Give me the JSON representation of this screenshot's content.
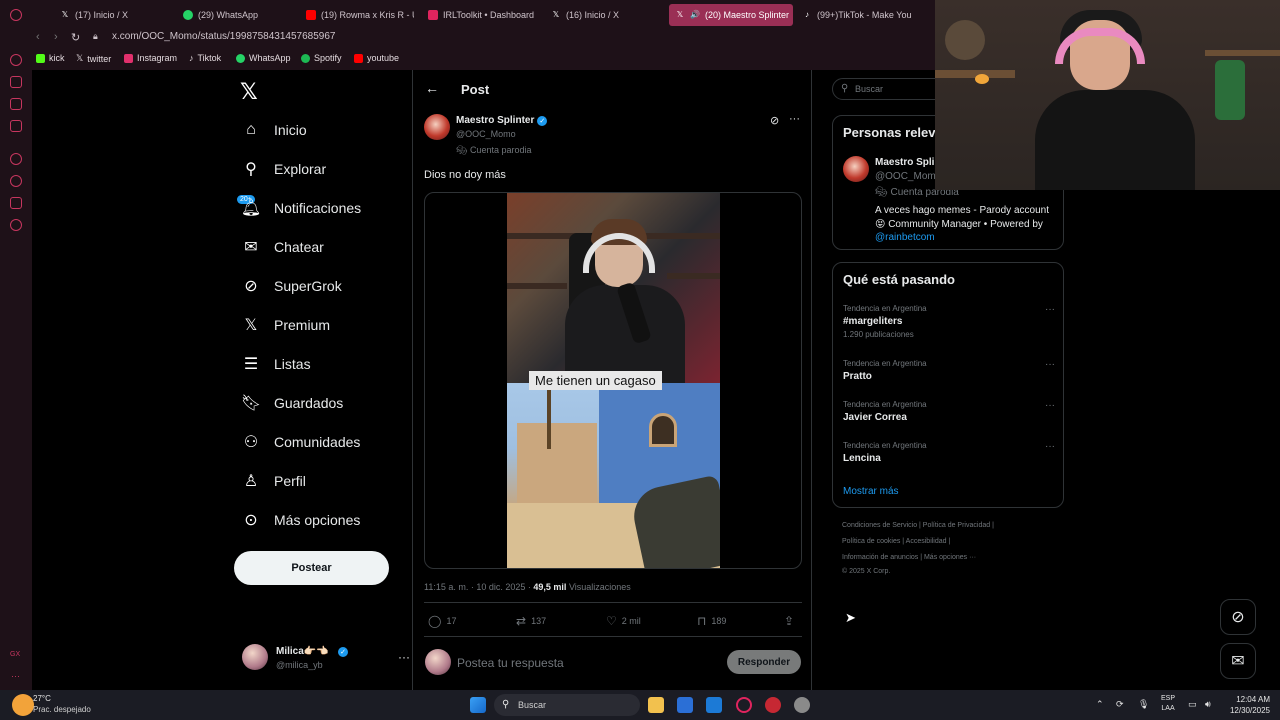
{
  "browser": {
    "tabs": [
      {
        "label": "(17) Inicio / X",
        "icon": "x-icon",
        "color": "#ffffff"
      },
      {
        "label": "(29) WhatsApp",
        "icon": "whatsapp-icon",
        "color": "#25d366"
      },
      {
        "label": "(19) Rowma x Kris R - Un",
        "icon": "youtube-icon",
        "color": "#ff0000"
      },
      {
        "label": "IRLToolkit • Dashboard",
        "icon": "irltoolkit-icon",
        "color": "#e0245e"
      },
      {
        "label": "(16) Inicio / X",
        "icon": "x-icon",
        "color": "#ffffff"
      },
      {
        "label": "(20) Maestro Splinter",
        "icon": "x-icon",
        "color": "#ffffff",
        "active": true
      },
      {
        "label": "(99+)TikTok - Make Your",
        "icon": "tiktok-icon",
        "color": "#ffffff"
      }
    ],
    "url": "x.com/OOC_Momo/status/1998758431457685967",
    "bookmarks": [
      {
        "label": "kick",
        "icon": "kick-icon",
        "color": "#53fc18"
      },
      {
        "label": "twitter",
        "icon": "x-icon",
        "color": "#ffffff"
      },
      {
        "label": "Instagram",
        "icon": "instagram-icon",
        "color": "#e1306c"
      },
      {
        "label": "Tiktok",
        "icon": "tiktok-icon",
        "color": "#ffffff"
      },
      {
        "label": "WhatsApp",
        "icon": "whatsapp-icon",
        "color": "#25d366"
      },
      {
        "label": "Spotify",
        "icon": "spotify-icon",
        "color": "#1db954"
      },
      {
        "label": "youtube",
        "icon": "youtube-icon",
        "color": "#ff0000"
      }
    ]
  },
  "leftnav": {
    "items": [
      {
        "label": "Inicio",
        "icon": "home-icon"
      },
      {
        "label": "Explorar",
        "icon": "search-icon"
      },
      {
        "label": "Notificaciones",
        "icon": "bell-icon",
        "badge": "20+"
      },
      {
        "label": "Chatear",
        "icon": "mail-icon"
      },
      {
        "label": "SuperGrok",
        "icon": "grok-icon"
      },
      {
        "label": "Premium",
        "icon": "x-icon"
      },
      {
        "label": "Listas",
        "icon": "list-icon"
      },
      {
        "label": "Guardados",
        "icon": "bookmark-icon"
      },
      {
        "label": "Comunidades",
        "icon": "community-icon"
      },
      {
        "label": "Perfil",
        "icon": "profile-icon"
      },
      {
        "label": "Más opciones",
        "icon": "more-icon"
      }
    ],
    "post_button": "Postear",
    "profile": {
      "name": "Milica👉🏻👈🏻",
      "handle": "@milica_yb"
    }
  },
  "post": {
    "header": "Post",
    "author": {
      "name": "Maestro Splinter",
      "handle": "@OOC_Momo",
      "label": "Cuenta parodia"
    },
    "text": "Dios no doy más",
    "video_caption": "Me tienen un cagaso",
    "timestamp": "11:15 a. m. · 10 dic. 2025 · ",
    "views": "49,5 mil",
    "views_label": " Visualizaciones",
    "actions": {
      "replies": "17",
      "reposts": "137",
      "likes": "2 mil",
      "bookmarks": "189"
    },
    "reply_placeholder": "Postea tu respuesta",
    "reply_button": "Responder"
  },
  "sidebar": {
    "search_placeholder": "Buscar",
    "relevant": {
      "title": "Personas relevantes",
      "name": "Maestro Splinter",
      "handle": "@OOC_Momo",
      "label": "Cuenta parodia",
      "bio": "A veces hago memes - Parody account 😝 Community Manager • Powered by ",
      "bio_link": "@rainbetcom"
    },
    "trends_title": "Qué está pasando",
    "trends": [
      {
        "context": "Tendencia en Argentina",
        "name": "#margeliters",
        "count": "1.290 publicaciones"
      },
      {
        "context": "Tendencia en Argentina",
        "name": "Pratto",
        "count": ""
      },
      {
        "context": "Tendencia en Argentina",
        "name": "Javier Correa",
        "count": ""
      },
      {
        "context": "Tendencia en Argentina",
        "name": "Lencina",
        "count": ""
      }
    ],
    "show_more": "Mostrar más",
    "footer": [
      "Condiciones de Servicio  |  Política de Privacidad  |",
      "Política de cookies  |  Accesibilidad  |",
      "Información de anuncios  |  Más opciones ···",
      "© 2025 X Corp."
    ]
  },
  "taskbar": {
    "temperature": "27°C",
    "condition": "Prac. despejado",
    "search_label": "Buscar",
    "lang": [
      "ESP",
      "LAA"
    ],
    "time": "12:04 AM",
    "date": "12/30/2025"
  },
  "colors": {
    "accent": "#1d9bf0",
    "opera": "#c7365f",
    "active_tab": "#9a2f55"
  }
}
